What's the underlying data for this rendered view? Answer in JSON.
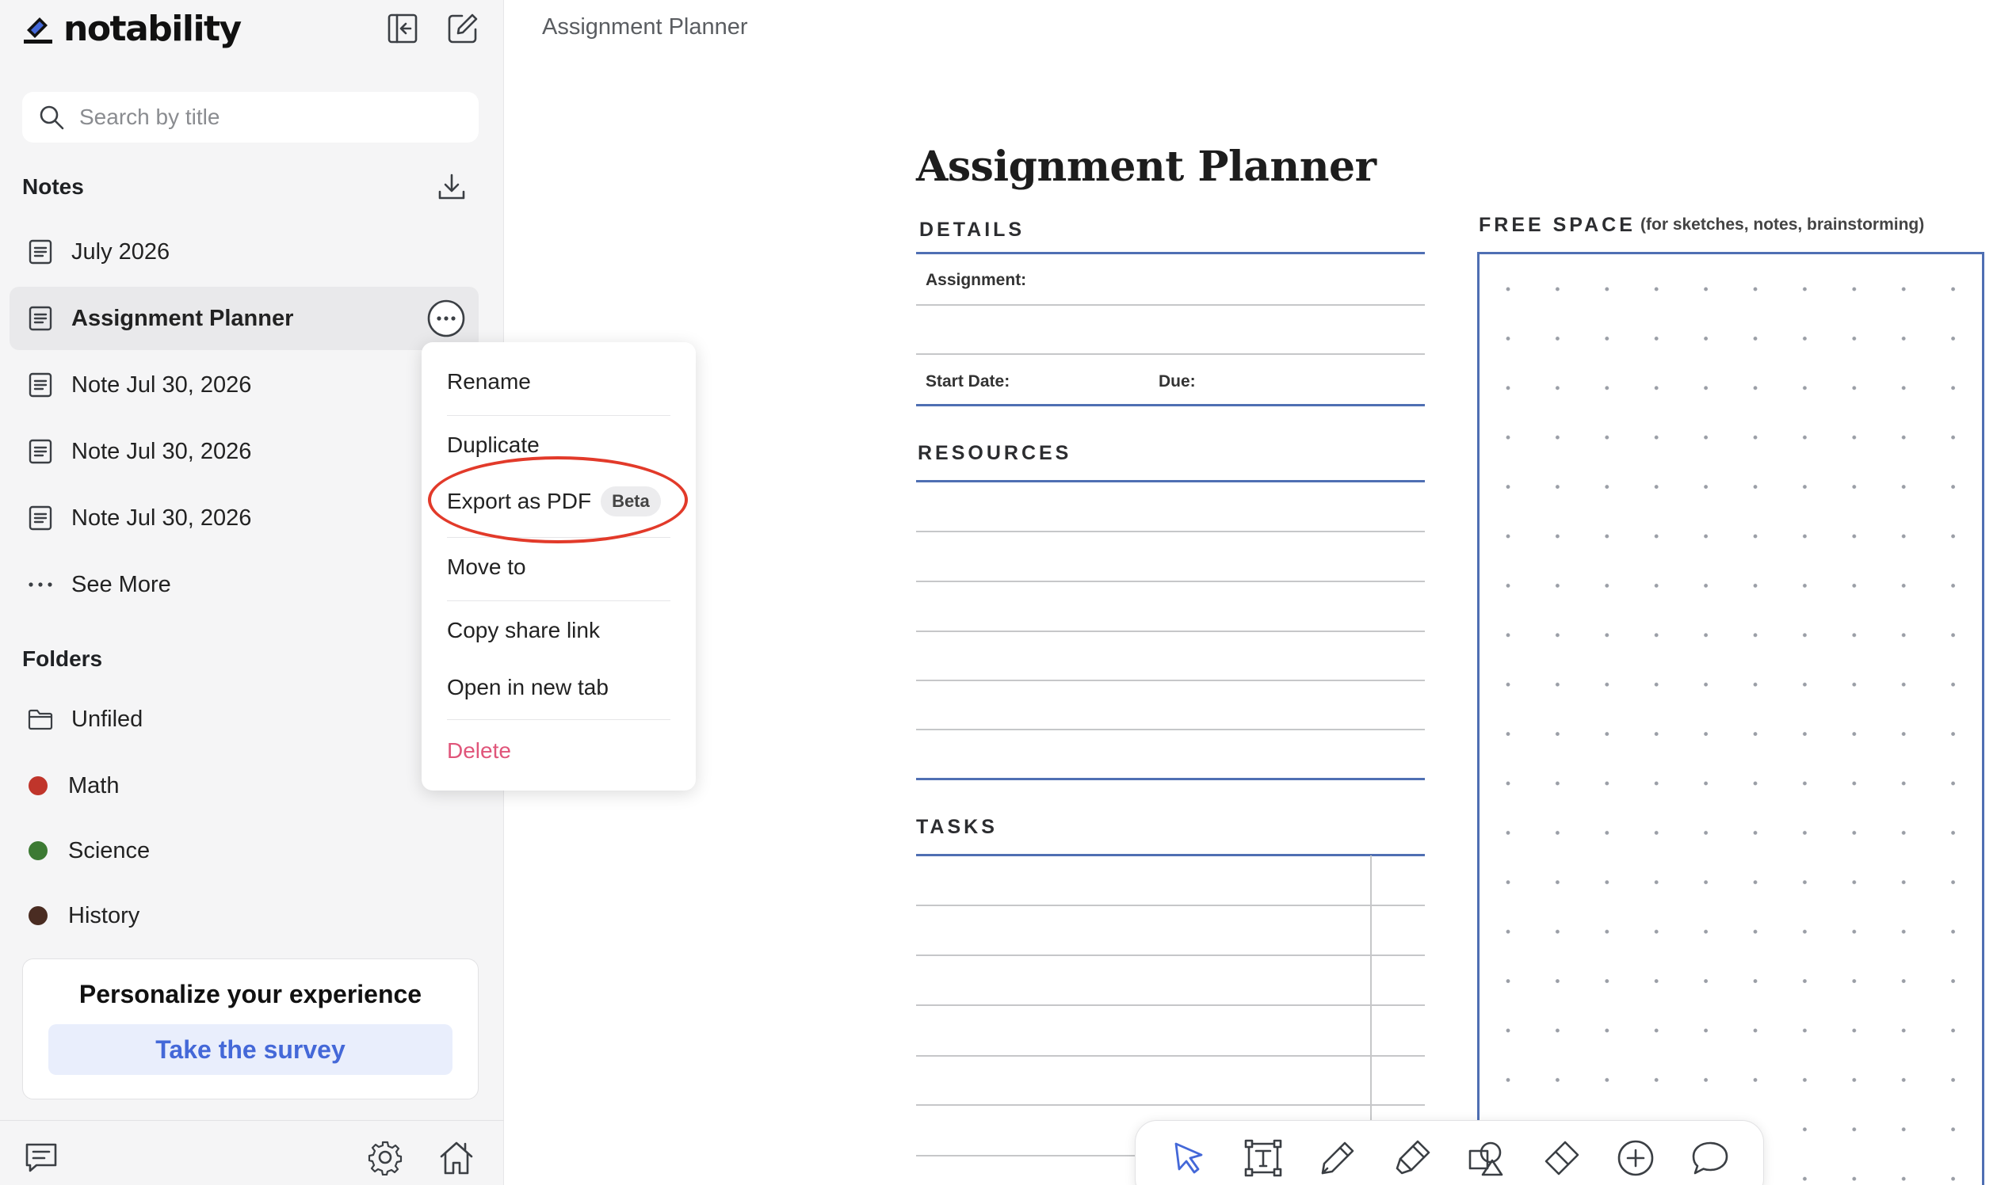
{
  "app": {
    "name": "notability"
  },
  "search": {
    "placeholder": "Search by title"
  },
  "notes": {
    "title": "Notes",
    "items": [
      {
        "label": "July 2026"
      },
      {
        "label": "Assignment Planner",
        "active": true
      },
      {
        "label": "Note Jul 30, 2026"
      },
      {
        "label": "Note Jul 30, 2026"
      },
      {
        "label": "Note Jul 30, 2026"
      }
    ],
    "see_more": "See More"
  },
  "folders": {
    "title": "Folders",
    "items": [
      {
        "label": "Unfiled",
        "icon": "folder-icon"
      },
      {
        "label": "Math",
        "color": "#c0352b"
      },
      {
        "label": "Science",
        "color": "#3c7a33"
      },
      {
        "label": "History",
        "color": "#4a2c22"
      }
    ]
  },
  "survey": {
    "title": "Personalize your experience",
    "button": "Take the survey"
  },
  "context_menu": {
    "rename": "Rename",
    "duplicate": "Duplicate",
    "export_pdf": "Export as PDF",
    "beta": "Beta",
    "move_to": "Move to",
    "copy_link": "Copy share link",
    "open_tab": "Open in new tab",
    "delete": "Delete",
    "delete_color": "#e0557a",
    "highlight_color": "#e23a2a"
  },
  "document": {
    "breadcrumb": "Assignment Planner",
    "title": "Assignment Planner",
    "details": "DETAILS",
    "assignment": "Assignment:",
    "start_date": "Start Date:",
    "due": "Due:",
    "resources": "RESOURCES",
    "tasks": "TASKS",
    "free_space": "FREE SPACE",
    "free_space_sub": "(for sketches, notes, brainstorming)",
    "accent": "#4f6fb3"
  },
  "toolbar": {
    "tools": [
      "select-icon",
      "text-box-icon",
      "pencil-icon",
      "highlighter-icon",
      "shapes-icon",
      "eraser-icon",
      "add-icon",
      "comment-icon"
    ],
    "active_color": "#4468d8"
  }
}
